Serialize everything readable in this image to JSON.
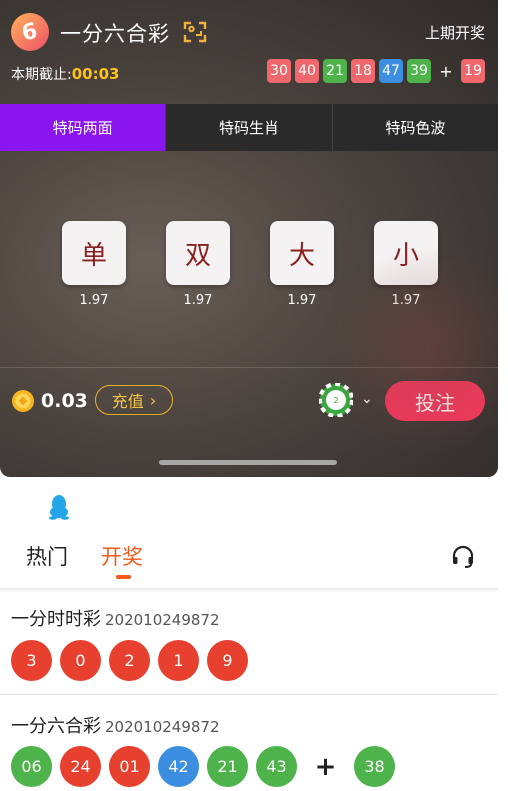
{
  "header": {
    "logo_text": "6",
    "title": "一分六合彩",
    "prev_draw_label": "上期开奖",
    "deadline_label": "本期截止:",
    "deadline_time": "00:03",
    "last_draw": {
      "numbers": [
        {
          "value": "30",
          "color": "#f0686b"
        },
        {
          "value": "40",
          "color": "#f0686b"
        },
        {
          "value": "21",
          "color": "#4db34a"
        },
        {
          "value": "18",
          "color": "#f0686b"
        },
        {
          "value": "47",
          "color": "#3b8ee0"
        },
        {
          "value": "39",
          "color": "#4db34a"
        }
      ],
      "plus": "+",
      "special": {
        "value": "19",
        "color": "#f0686b"
      }
    }
  },
  "tabs": [
    {
      "label": "特码两面",
      "active": true
    },
    {
      "label": "特码生肖",
      "active": false
    },
    {
      "label": "特码色波",
      "active": false
    }
  ],
  "bets": [
    {
      "label": "单",
      "odds": "1.97"
    },
    {
      "label": "双",
      "odds": "1.97"
    },
    {
      "label": "大",
      "odds": "1.97"
    },
    {
      "label": "小",
      "odds": "1.97"
    }
  ],
  "footer_bar": {
    "balance": "0.03",
    "recharge_label": "充值",
    "chip_value": "2",
    "bet_button_label": "投注"
  },
  "nav": {
    "hot_label": "热门",
    "draw_label": "开奖"
  },
  "lotteries": [
    {
      "name": "一分时时彩",
      "issue": "202010249872",
      "balls": [
        {
          "value": "3",
          "color": "#e8402f"
        },
        {
          "value": "0",
          "color": "#e8402f"
        },
        {
          "value": "2",
          "color": "#e8402f"
        },
        {
          "value": "1",
          "color": "#e8402f"
        },
        {
          "value": "9",
          "color": "#e8402f"
        }
      ]
    },
    {
      "name": "一分六合彩",
      "issue": "202010249872",
      "balls": [
        {
          "value": "06",
          "color": "#4db34a"
        },
        {
          "value": "24",
          "color": "#e8402f"
        },
        {
          "value": "01",
          "color": "#e8402f"
        },
        {
          "value": "42",
          "color": "#3b8ee0"
        },
        {
          "value": "21",
          "color": "#4db34a"
        },
        {
          "value": "43",
          "color": "#4db34a"
        }
      ],
      "plus": "+",
      "special": {
        "value": "38",
        "color": "#4db34a"
      }
    }
  ],
  "icons": {
    "scan": "scan-icon",
    "coin": "coin-icon",
    "chip": "chip-icon",
    "penguin": "qq-penguin-icon",
    "headset": "headset-icon"
  }
}
